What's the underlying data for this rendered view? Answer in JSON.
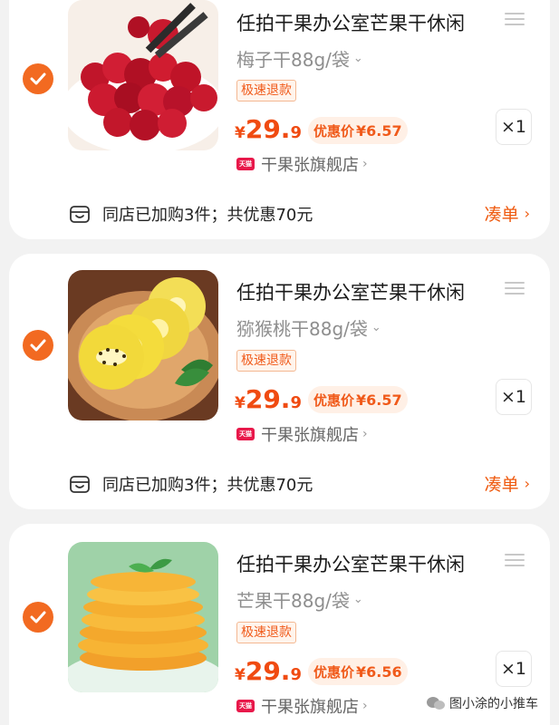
{
  "items": [
    {
      "title": "任拍干果办公室芒果干休闲",
      "variant": "梅子干88g/袋",
      "tag": "极速退款",
      "price_currency": "¥",
      "price_int": "29.",
      "price_dec": "9",
      "promo_label": "优惠价",
      "promo_value": "¥6.57",
      "qty": "×1",
      "store_badge": "天猫",
      "store": "干果张旗舰店",
      "bundle_text": "同店已加购3件；共优惠70元",
      "bundle_action": "凑单"
    },
    {
      "title": "任拍干果办公室芒果干休闲",
      "variant": "猕猴桃干88g/袋",
      "tag": "极速退款",
      "price_currency": "¥",
      "price_int": "29.",
      "price_dec": "9",
      "promo_label": "优惠价",
      "promo_value": "¥6.57",
      "qty": "×1",
      "store_badge": "天猫",
      "store": "干果张旗舰店",
      "bundle_text": "同店已加购3件；共优惠70元",
      "bundle_action": "凑单"
    },
    {
      "title": "任拍干果办公室芒果干休闲",
      "variant": "芒果干88g/袋",
      "tag": "极速退款",
      "price_currency": "¥",
      "price_int": "29.",
      "price_dec": "9",
      "promo_label": "优惠价",
      "promo_value": "¥6.56",
      "qty": "×1",
      "store_badge": "天猫",
      "store": "干果张旗舰店"
    }
  ],
  "watermark": "图小涂的小推车",
  "colors": {
    "accent": "#f26a21",
    "price": "#f04b12",
    "tmall": "#e8184a"
  }
}
